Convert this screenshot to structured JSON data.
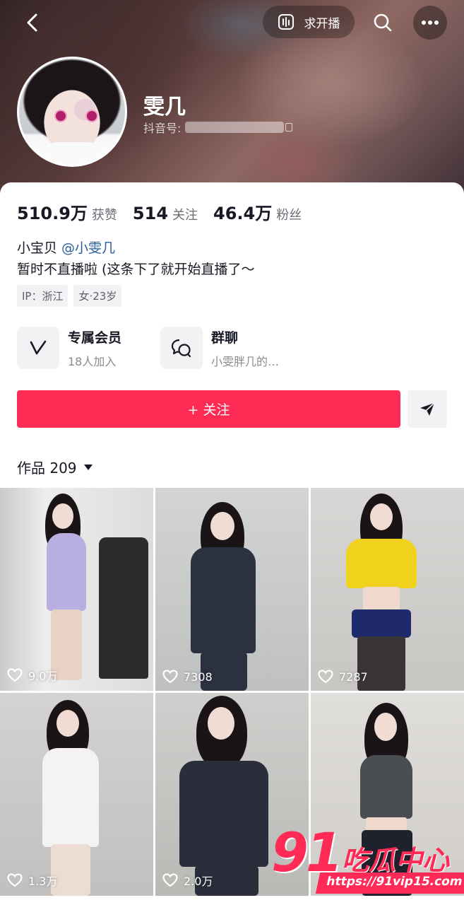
{
  "header": {
    "live_request_label": "求开播",
    "nickname": "雯几",
    "douyin_id_label": "抖音号:"
  },
  "stats": [
    {
      "value": "510.9万",
      "label": "获赞"
    },
    {
      "value": "514",
      "label": "关注"
    },
    {
      "value": "46.4万",
      "label": "粉丝"
    }
  ],
  "bio": {
    "line1_prefix": "小宝贝",
    "mention": "@小雯几",
    "line2": "暂时不直播啦 (这条下了就开始直播了～"
  },
  "tags": [
    "IP：浙江",
    "女·23岁"
  ],
  "features": {
    "vip": {
      "title": "专属会员",
      "subtitle": "18人加入"
    },
    "group": {
      "title": "群聊",
      "subtitle": "小雯胖几的…"
    }
  },
  "actions": {
    "follow_label": "+ 关注"
  },
  "works": {
    "label": "作品 209"
  },
  "videos": [
    {
      "likes": "9.0万"
    },
    {
      "likes": "7308"
    },
    {
      "likes": "7287"
    },
    {
      "likes": "1.3万"
    },
    {
      "likes": "2.0万"
    },
    {
      "likes": ""
    }
  ],
  "watermark": {
    "number": "91",
    "text": "吃瓜中心",
    "url": "https://91vip15.com"
  },
  "colors": {
    "accent": "#fe2c55",
    "mention": "#2b5c9a"
  }
}
